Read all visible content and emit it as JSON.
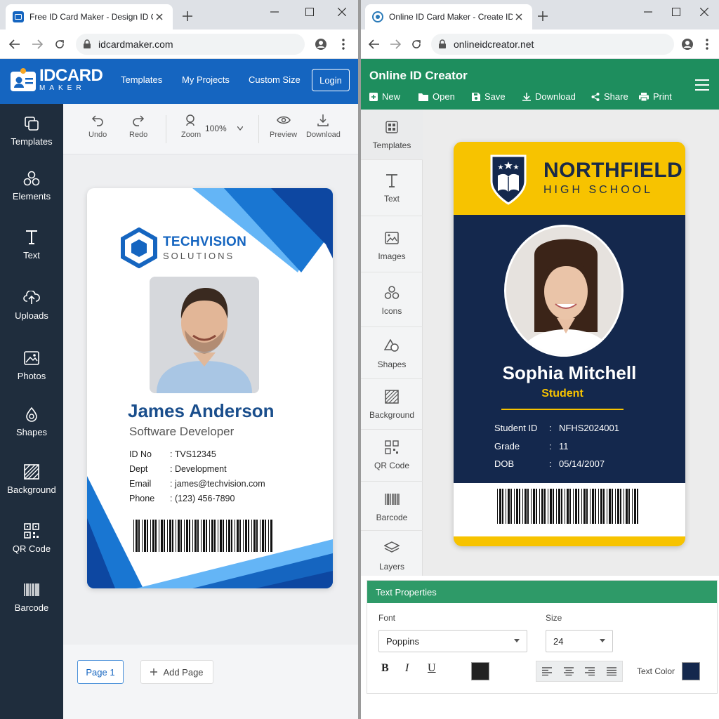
{
  "left": {
    "tab_title": "Free ID Card Maker - Design ID Online",
    "url": "idcardmaker.com",
    "logo": {
      "line1": "IDCARD",
      "line2": "MAKER"
    },
    "nav": [
      "Templates",
      "My Projects",
      "Custom Size"
    ],
    "login": "Login",
    "sidebar": [
      "Templates",
      "Elements",
      "Text",
      "Uploads",
      "Photos",
      "Shapes",
      "Background",
      "QR Code",
      "Barcode"
    ],
    "toolbar": {
      "undo": "Undo",
      "redo": "Redo",
      "zoom": "Zoom",
      "zoom_value": "100%",
      "preview": "Preview",
      "download": "Download"
    },
    "card": {
      "company1": "TECHVISION",
      "company2": "SOLUTIONS",
      "name": "James Anderson",
      "role": "Software Developer",
      "fields": [
        {
          "key": "ID No",
          "value": ": TVS12345"
        },
        {
          "key": "Dept",
          "value": ": Development"
        },
        {
          "key": "Email",
          "value": ": james@techvision.com"
        },
        {
          "key": "Phone",
          "value": ": (123) 456-7890"
        }
      ]
    },
    "footer": {
      "page": "Page 1",
      "add_page": "Add Page"
    }
  },
  "right": {
    "tab_title": "Online ID Card Maker - Create ID Card",
    "url": "onlineidcreator.net",
    "app_title": "Online ID Creator",
    "actions": [
      "New",
      "Open",
      "Save",
      "Download",
      "Share",
      "Print"
    ],
    "sidebar": [
      "Templates",
      "Text",
      "Images",
      "Icons",
      "Shapes",
      "Background",
      "QR Code",
      "Barcode",
      "Layers"
    ],
    "card": {
      "school1": "NORTHFIELD",
      "school2": "HIGH SCHOOL",
      "name": "Sophia Mitchell",
      "role": "Student",
      "fields": [
        {
          "key": "Student ID",
          "value": "NFHS2024001"
        },
        {
          "key": "Grade",
          "value": "11"
        },
        {
          "key": "DOB",
          "value": "05/14/2007"
        }
      ]
    },
    "text_props": {
      "title": "Text Properties",
      "font_label": "Font",
      "font_value": "Poppins",
      "size_label": "Size",
      "size_value": "24",
      "bold": "B",
      "italic": "I",
      "underline": "U",
      "text_color_label": "Text Color",
      "text_color": "#14284d"
    }
  },
  "colors": {
    "left_brand": "#1565c0",
    "right_brand": "#1e8e5e",
    "card2_accent": "#f7c300",
    "card2_navy": "#14284d"
  }
}
